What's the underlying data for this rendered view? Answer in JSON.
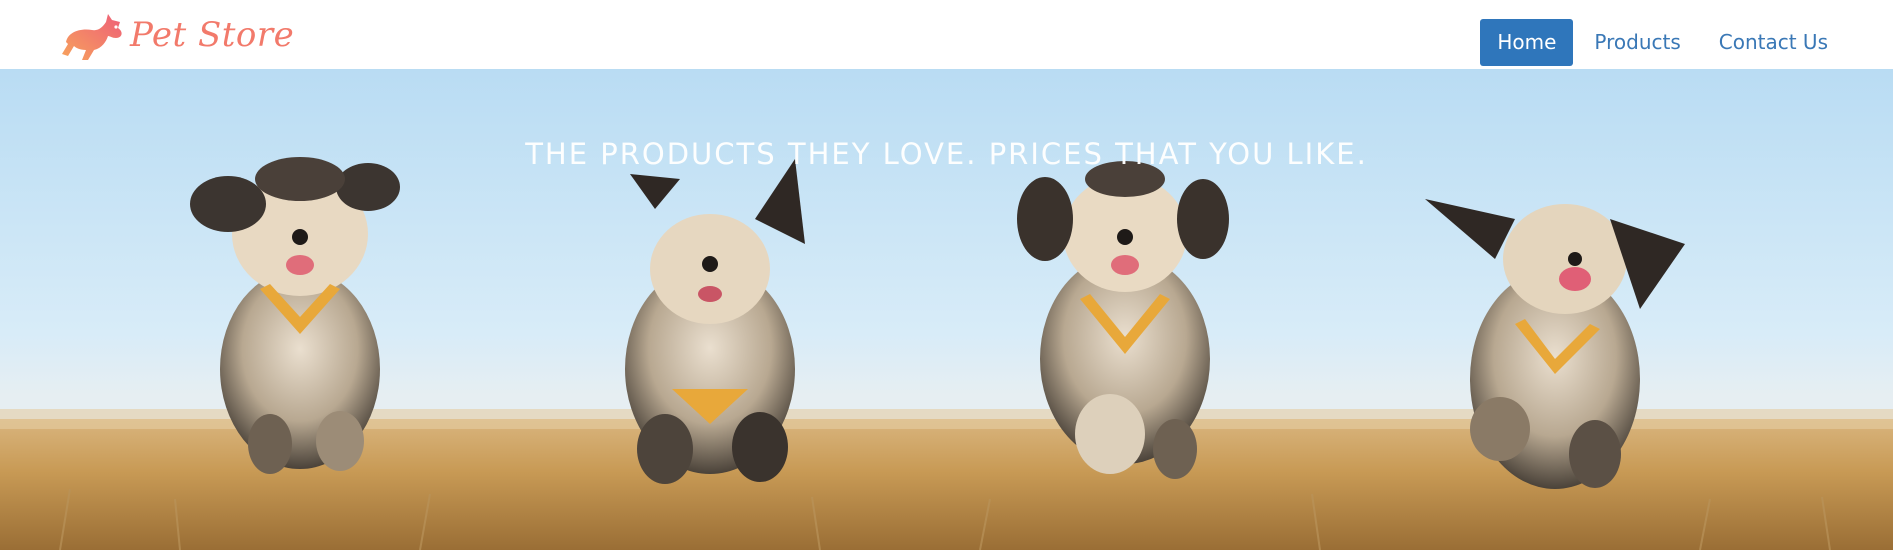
{
  "brand": {
    "name": "Pet Store",
    "logo_icon": "running-pet-icon",
    "color": "#f27a6b"
  },
  "nav": {
    "items": [
      {
        "label": "Home",
        "active": true
      },
      {
        "label": "Products",
        "active": false
      },
      {
        "label": "Contact Us",
        "active": false
      }
    ],
    "active_color": "#2f76bb",
    "link_color": "#3a78b6"
  },
  "hero": {
    "tagline": "THE PRODUCTS THEY LOVE. PRICES THAT YOU LIKE.",
    "image": "photo of four small dogs running through dry grass under a blue sky"
  }
}
